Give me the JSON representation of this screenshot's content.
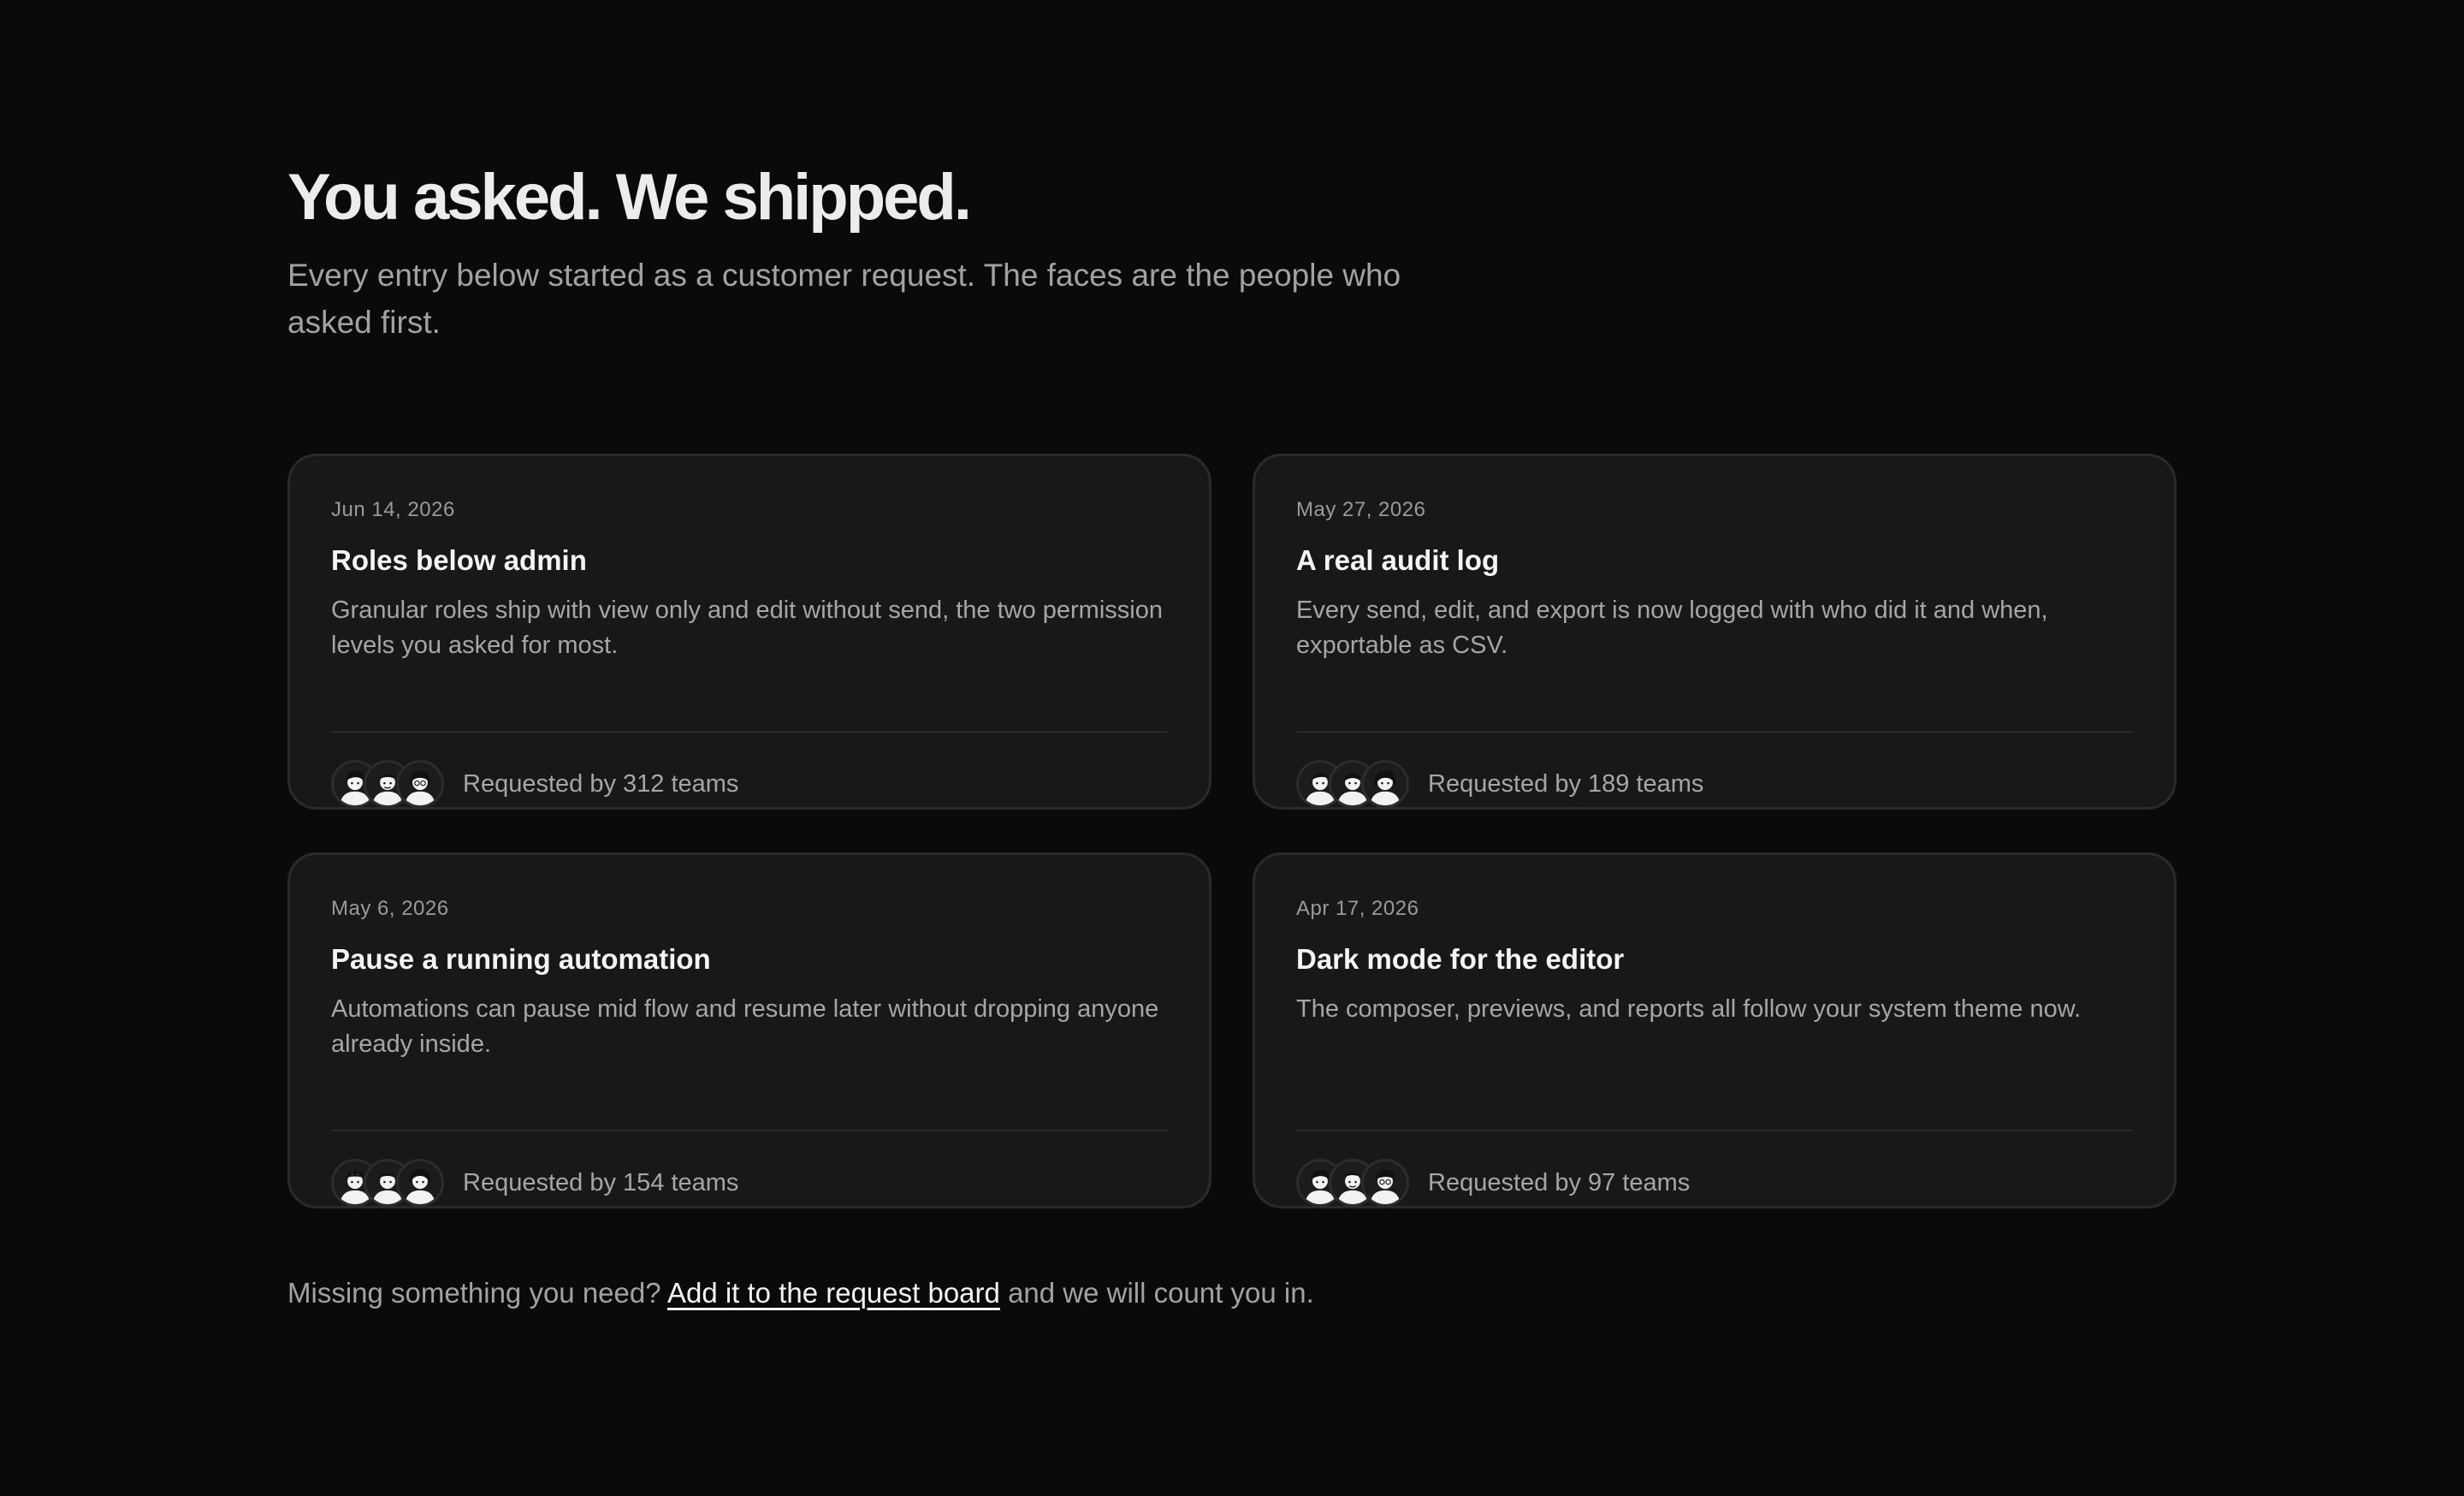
{
  "header": {
    "title": "You asked. We shipped.",
    "subtitle": "Every entry below started as a customer request. The faces are the people who asked first."
  },
  "cards": [
    {
      "date": "Jun 14, 2026",
      "title": "Roles below admin",
      "description": "Granular roles ship with view only and edit without send, the two permission levels you asked for most.",
      "requested": "Requested by 312 teams",
      "avatars": [
        "person-avatar-icon",
        "person-avatar-icon",
        "person-avatar-icon"
      ]
    },
    {
      "date": "May 27, 2026",
      "title": "A real audit log",
      "description": "Every send, edit, and export is now logged with who did it and when, exportable as CSV.",
      "requested": "Requested by 189 teams",
      "avatars": [
        "person-avatar-icon",
        "person-avatar-icon",
        "person-avatar-icon"
      ]
    },
    {
      "date": "May 6, 2026",
      "title": "Pause a running automation",
      "description": "Automations can pause mid flow and resume later without dropping anyone already inside.",
      "requested": "Requested by 154 teams",
      "avatars": [
        "person-avatar-icon",
        "person-avatar-icon",
        "person-avatar-icon"
      ]
    },
    {
      "date": "Apr 17, 2026",
      "title": "Dark mode for the editor",
      "description": "The composer, previews, and reports all follow your system theme now.",
      "requested": "Requested by 97 teams",
      "avatars": [
        "person-avatar-icon",
        "person-avatar-icon",
        "person-avatar-icon"
      ]
    }
  ],
  "footer": {
    "prefix": "Missing something you need?",
    "link_label": "Add it to the request board",
    "suffix": "and we will count you in."
  },
  "colors": {
    "background": "#0a0a0a",
    "card": "#181818",
    "border": "#2a2a2a",
    "text_primary": "#f4f4f4",
    "text_muted": "#a6a6a6"
  }
}
